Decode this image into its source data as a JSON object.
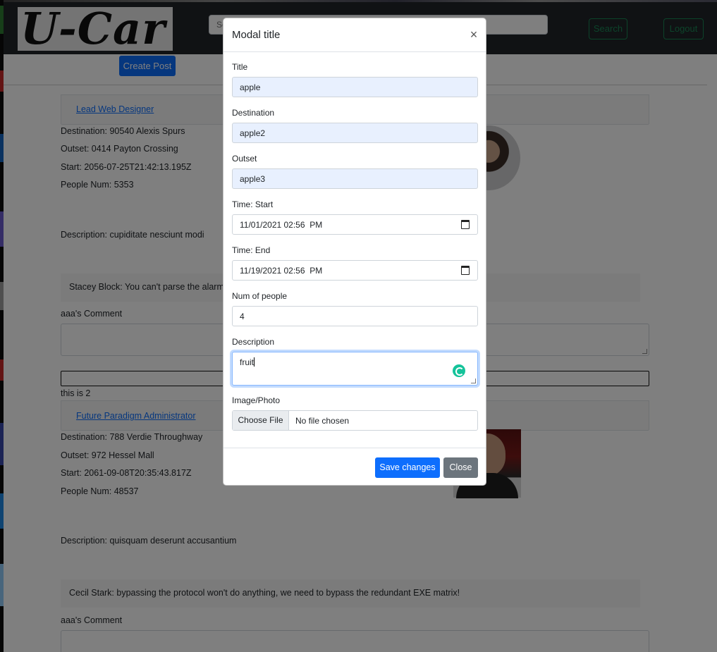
{
  "navbar": {
    "logo_text": "U-Car",
    "search_placeholder": "Search",
    "search_button": "Search",
    "logout_button": "Logout"
  },
  "create_post_label": "Create Post",
  "posts": [
    {
      "title": "Lead Web Designer",
      "destination": "Destination: 90540 Alexis Spurs",
      "outset": "Outset: 0414 Payton Crossing",
      "start": "Start: 2056-07-25T21:42:13.195Z",
      "people": "People Num: 5353",
      "description": "Description: cupiditate nesciunt modi",
      "comment": "Stacey Block: You can't parse the alarm wi",
      "comment_label": "aaa's Comment",
      "footer_text": "this is 2"
    },
    {
      "title": "Future Paradigm Administrator",
      "destination": "Destination: 788 Verdie Throughway",
      "outset": "Outset: 972 Hessel Mall",
      "start": "Start: 2061-09-08T20:35:43.817Z",
      "people": "People Num: 48537",
      "description": "Description: quisquam deserunt accusantium",
      "comment": "Cecil Stark: bypassing the protocol won't do anything, we need to bypass the redundant EXE matrix!",
      "comment_label": "aaa's Comment"
    }
  ],
  "modal": {
    "title": "Modal title",
    "close_symbol": "×",
    "fields": {
      "title_label": "Title",
      "title_value": "apple",
      "destination_label": "Destination",
      "destination_value": "apple2",
      "outset_label": "Outset",
      "outset_value": "apple3",
      "time_start_label": "Time: Start",
      "time_start_value": "11/01/2021 02:56  PM",
      "time_end_label": "Time: End",
      "time_end_value": "11/19/2021 02:56  PM",
      "num_people_label": "Num of people",
      "num_people_value": "4",
      "description_label": "Description",
      "description_value": "fruit",
      "image_label": "Image/Photo",
      "file_button": "Choose File",
      "file_status": "No file chosen"
    },
    "save_button": "Save changes",
    "close_button": "Close"
  },
  "colors": {
    "primary": "#0d6efd",
    "secondary": "#6c757d",
    "success_outline": "#198754",
    "navbar": "#212529",
    "autofill": "#e8f0fe",
    "grammarly": "#15c39a"
  },
  "icons": {
    "calendar": "calendar-icon",
    "close": "close-icon",
    "grammarly": "grammarly-icon"
  }
}
